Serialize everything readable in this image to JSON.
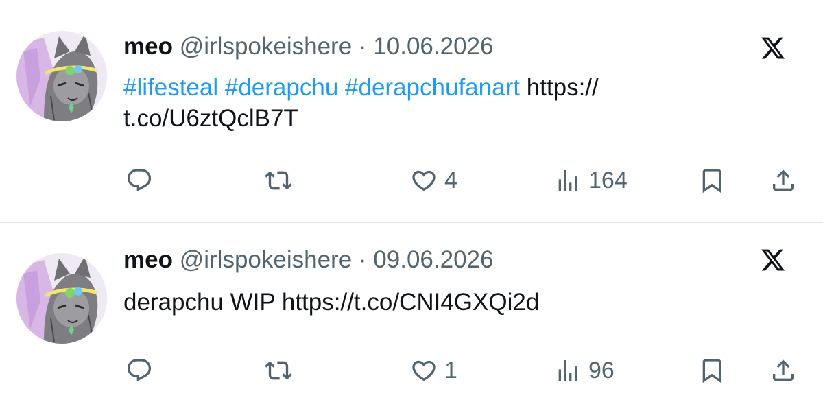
{
  "tweets": [
    {
      "name": "meo",
      "handle": "@irlspokeishere",
      "separator": "·",
      "date": "10.06.2026",
      "hashtags": [
        "#lifesteal",
        "#derapchu",
        "#derapchufanart"
      ],
      "link_part1": "https://",
      "link_part2": "t.co/U6ztQclB7T",
      "likes": "4",
      "views": "164"
    },
    {
      "name": "meo",
      "handle": "@irlspokeishere",
      "separator": "·",
      "date": "09.06.2026",
      "text": "derapchu WIP https://t.co/CNI4GXQi2d",
      "likes": "1",
      "views": "96"
    }
  ],
  "colors": {
    "text": "#0f1419",
    "muted": "#536471",
    "link": "#1d9bf0",
    "divider": "#e6e9eb"
  },
  "icons": [
    "x-logo-icon",
    "reply-icon",
    "retweet-icon",
    "heart-icon",
    "views-icon",
    "bookmark-icon",
    "share-icon"
  ]
}
